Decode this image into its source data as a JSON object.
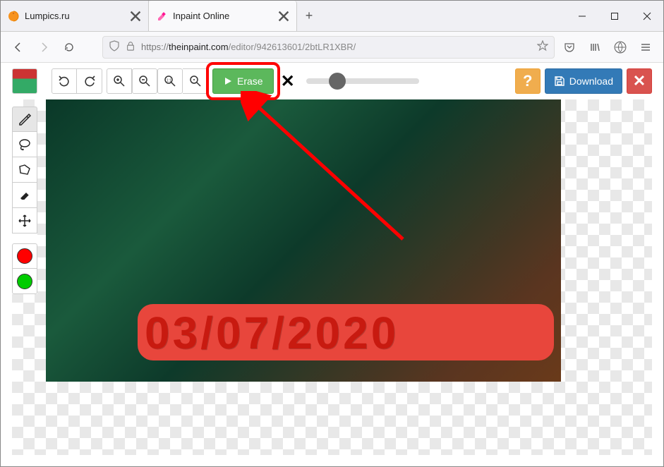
{
  "window": {
    "tabs": [
      {
        "title": "Lumpics.ru",
        "favicon": "orange",
        "active": false
      },
      {
        "title": "Inpaint Online",
        "favicon": "eraser",
        "active": true
      }
    ]
  },
  "urlbar": {
    "scheme_label": "https://",
    "host": "theinpaint.com",
    "path": "/editor/942613601/2btLR1XBR/"
  },
  "app_toolbar": {
    "erase_label": "Erase",
    "download_label": "Download",
    "help_label": "?"
  },
  "side_tools": [
    "marker",
    "lasso",
    "polygon",
    "eraser",
    "move"
  ],
  "mask_colors": {
    "remove": "#ff0000",
    "keep": "#00cc00"
  },
  "canvas": {
    "date_stamp": "03/07/2020"
  },
  "slider_value_percent": 28,
  "colors": {
    "erase_btn": "#5cb85c",
    "download_btn": "#337ab7",
    "help_btn": "#f0ad4e",
    "close_btn": "#d9534f",
    "highlight": "#ff0000"
  }
}
